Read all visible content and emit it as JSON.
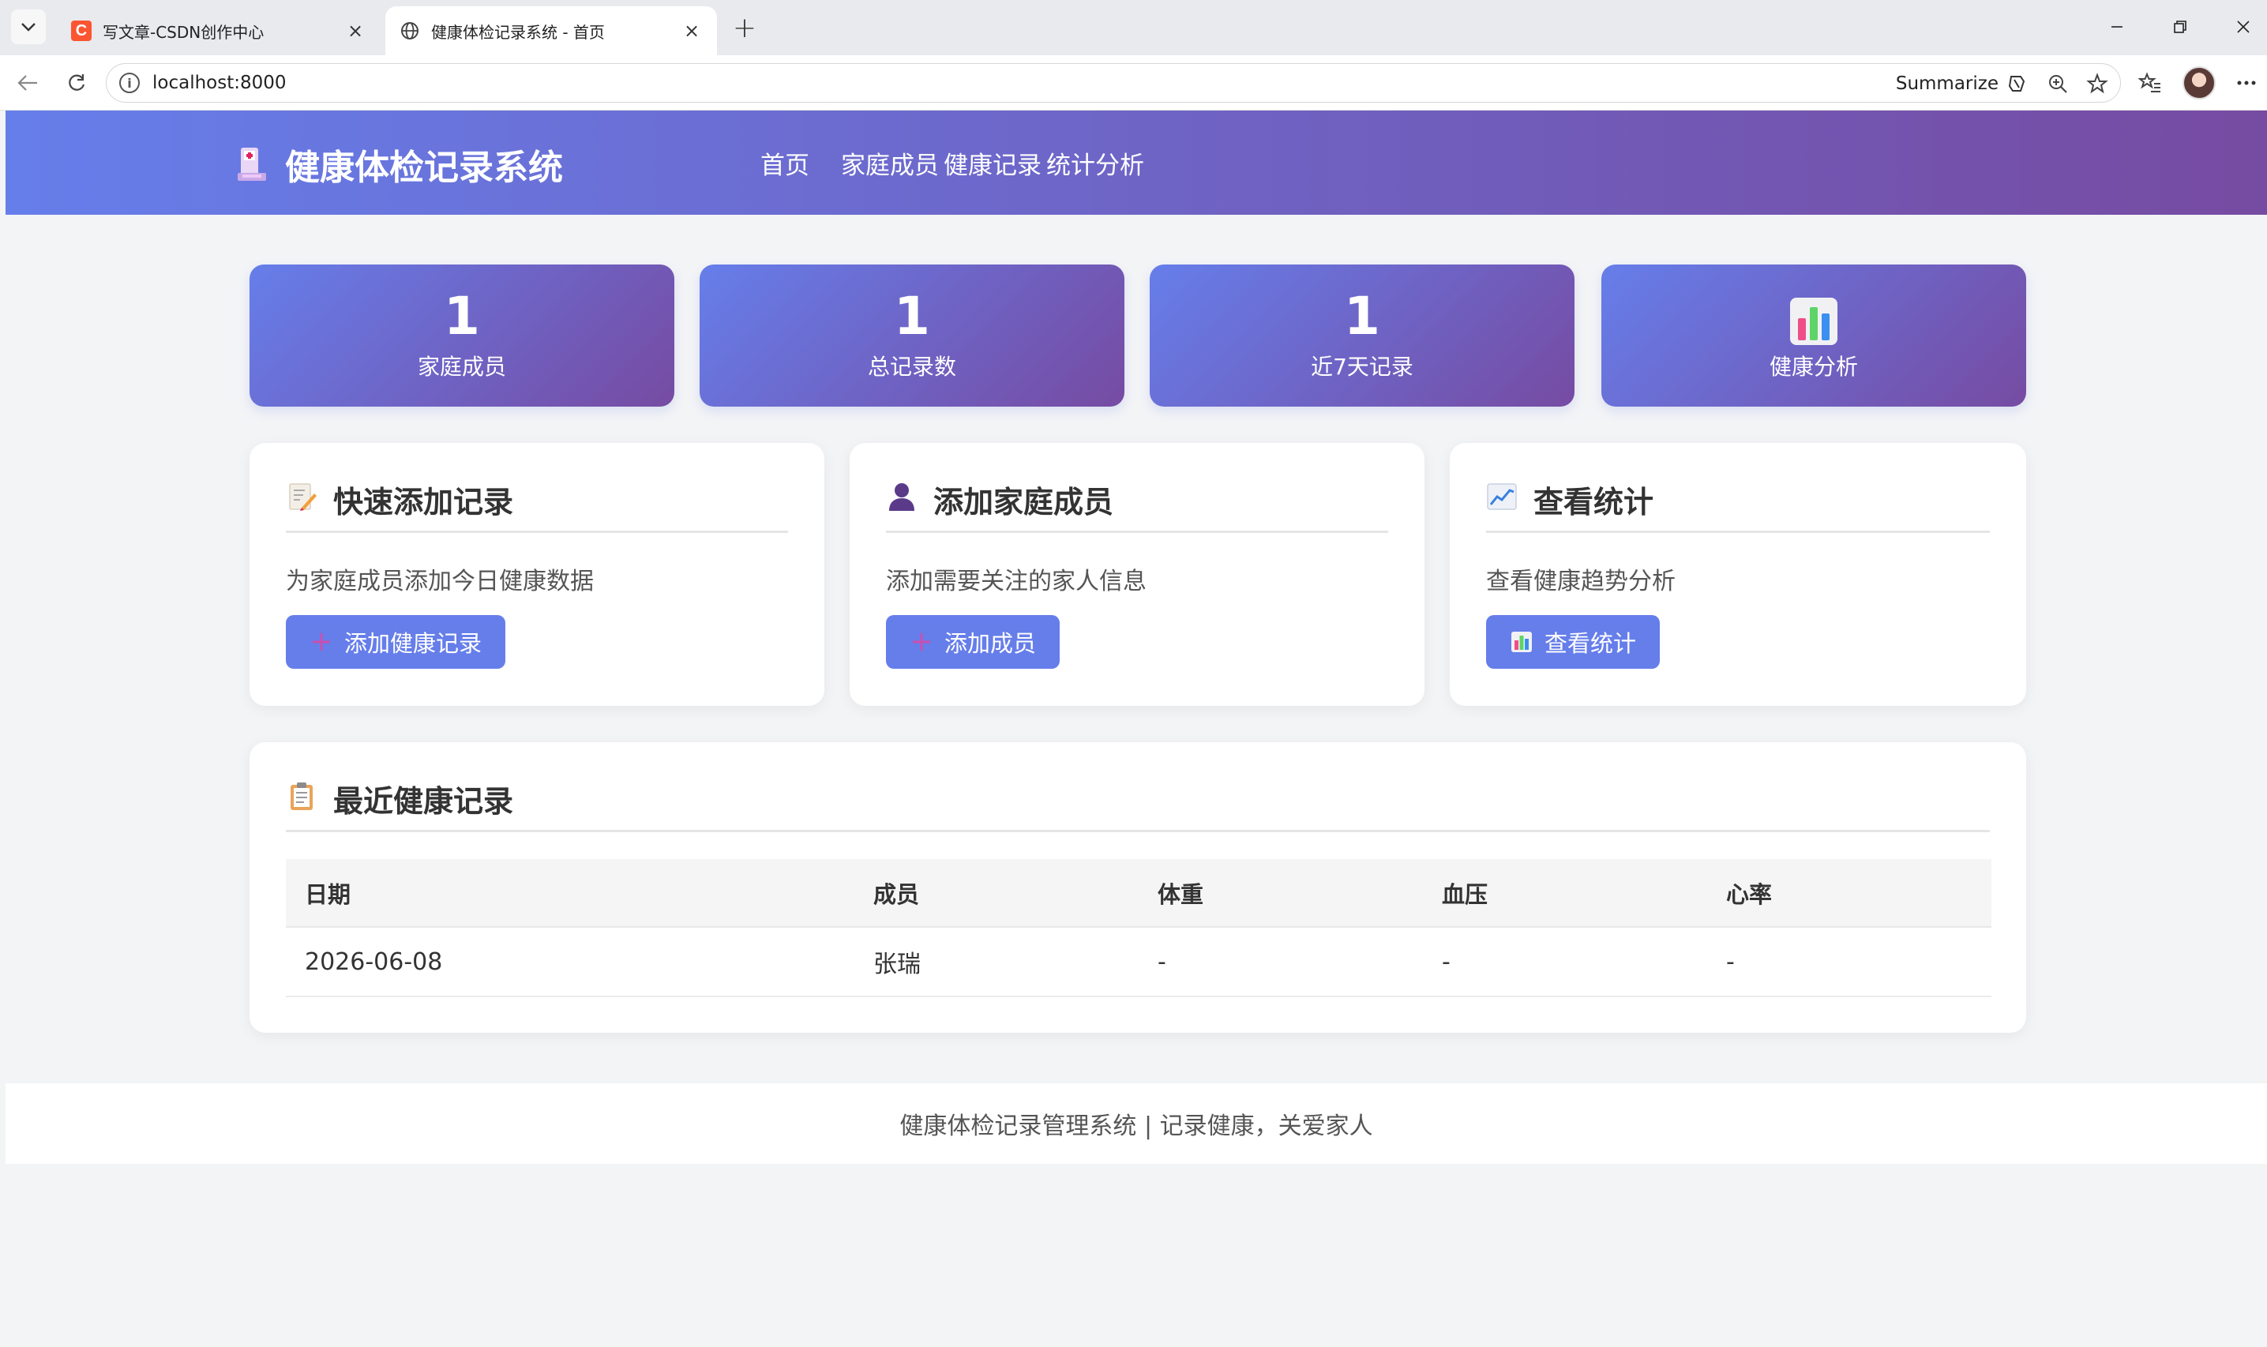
{
  "browser": {
    "tabs": [
      {
        "title": "写文章-CSDN创作中心",
        "icon": "csdn-favicon",
        "active": false
      },
      {
        "title": "健康体检记录系统 - 首页",
        "icon": "globe-icon",
        "active": true
      }
    ],
    "url": "localhost:8000",
    "summarize_label": "Summarize"
  },
  "header": {
    "brand": "健康体检记录系统",
    "nav": [
      "首页",
      "家庭成员",
      "健康记录",
      "统计分析"
    ]
  },
  "stats": [
    {
      "value": "1",
      "label": "家庭成员"
    },
    {
      "value": "1",
      "label": "总记录数"
    },
    {
      "value": "1",
      "label": "近7天记录"
    },
    {
      "icon": "bar-chart-icon",
      "label": "健康分析"
    }
  ],
  "actions": [
    {
      "title": "快速添加记录",
      "icon": "memo-icon",
      "desc": "为家庭成员添加今日健康数据",
      "button": "添加健康记录",
      "button_icon": "plus-icon"
    },
    {
      "title": "添加家庭成员",
      "icon": "person-icon",
      "desc": "添加需要关注的家人信息",
      "button": "添加成员",
      "button_icon": "plus-icon"
    },
    {
      "title": "查看统计",
      "icon": "trend-chart-icon",
      "desc": "查看健康趋势分析",
      "button": "查看统计",
      "button_icon": "bar-chart-icon"
    }
  ],
  "recent": {
    "title": "最近健康记录",
    "icon": "clipboard-icon",
    "columns": [
      "日期",
      "成员",
      "体重",
      "血压",
      "心率"
    ],
    "rows": [
      [
        "2026-06-08",
        "张瑞",
        "-",
        "-",
        "-"
      ]
    ]
  },
  "footer": "健康体检记录管理系统 | 记录健康，关爱家人",
  "colors": {
    "gradient_start": "#667eea",
    "gradient_end": "#764ba2",
    "button": "#667eea"
  }
}
